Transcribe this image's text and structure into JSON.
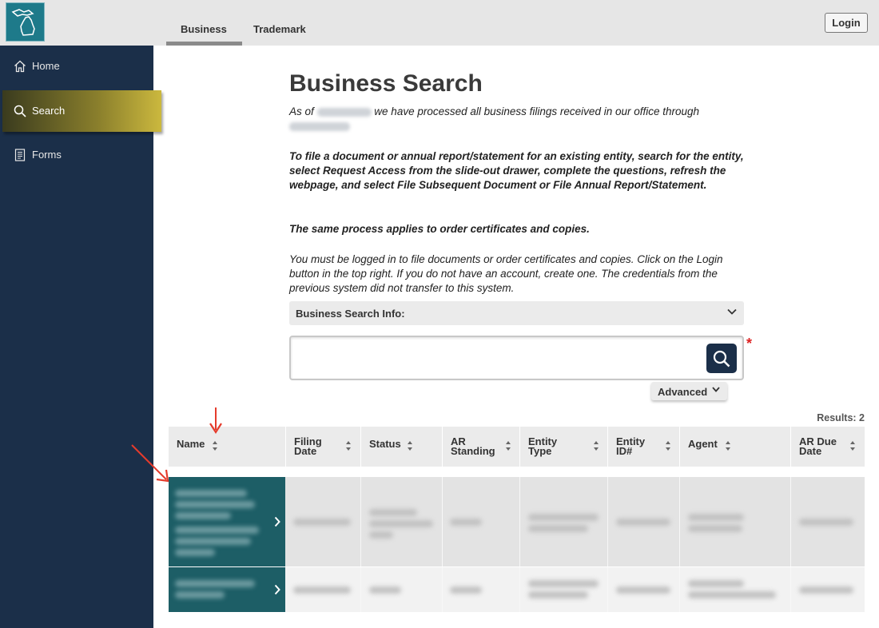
{
  "header": {
    "tabs": [
      {
        "label": "Business",
        "active": true
      },
      {
        "label": "Trademark",
        "active": false
      }
    ],
    "login_label": "Login"
  },
  "sidebar": {
    "items": [
      {
        "label": "Home",
        "icon": "home-icon"
      },
      {
        "label": "Search",
        "icon": "search-icon",
        "active": true
      },
      {
        "label": "Forms",
        "icon": "document-icon"
      }
    ]
  },
  "main": {
    "title": "Business Search",
    "as_of_prefix": "As of",
    "as_of_middle": "we have processed all business filings received in our office",
    "as_of_suffix": "through",
    "instructions_bold": "To file a document or annual report/statement for an existing entity, search for the entity, select Request Access from the slide-out drawer, complete the questions, refresh the webpage, and select File Subsequent Document or File Annual Report/Statement.",
    "same_process": "The same process applies to order certificates and copies.",
    "login_note": "You must be logged in to file documents or order certificates and copies. Click on the Login button in the top right. If you do not have an account, create one. The credentials from the previous system did not transfer to this system.",
    "info_accordion_label": "Business Search Info:",
    "search": {
      "value": "",
      "placeholder": "",
      "required_mark": "*"
    },
    "advanced_label": "Advanced",
    "results_label": "Results: 2"
  },
  "table": {
    "columns": [
      {
        "key": "name",
        "label": "Name"
      },
      {
        "key": "filing_date",
        "label": "Filing Date"
      },
      {
        "key": "status",
        "label": "Status"
      },
      {
        "key": "ar_standing",
        "label": "AR Standing"
      },
      {
        "key": "entity_type",
        "label": "Entity Type"
      },
      {
        "key": "entity_id",
        "label": "Entity ID#"
      },
      {
        "key": "agent",
        "label": "Agent"
      },
      {
        "key": "ar_due_date",
        "label": "AR Due Date"
      }
    ],
    "row_count": 2
  },
  "colors": {
    "sidebar_bg": "#1b2f49",
    "active_nav_gold": "#cbb83e",
    "name_cell_teal": "#1d5e66",
    "annotation_arrow": "#e53b2c"
  }
}
